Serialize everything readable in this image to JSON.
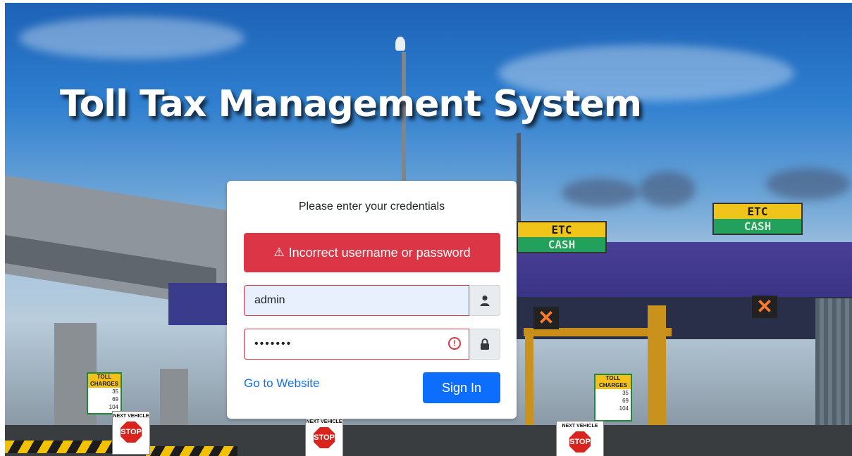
{
  "app": {
    "title": "Toll Tax Management System"
  },
  "scenery": {
    "etc_sign_top": "ETC",
    "etc_sign_bottom": "CASH",
    "toll_board_header": "TOLL CHARGES",
    "toll_board_rows": [
      "35",
      "69",
      "104"
    ],
    "stop_sign_caption": "NEXT VEHICLE",
    "stop_sign_text": "STOP",
    "lane_closed_symbol": "✕"
  },
  "login": {
    "prompt": "Please enter your credentials",
    "error_icon": "warning-triangle-icon",
    "error_message": "Incorrect username or password",
    "username_value": "admin",
    "username_icon": "user-icon",
    "password_value": "•••••••",
    "password_icon": "lock-icon",
    "website_link": "Go to Website",
    "sign_in_label": "Sign In"
  },
  "colors": {
    "danger": "#dc3545",
    "primary": "#0d6efd"
  }
}
